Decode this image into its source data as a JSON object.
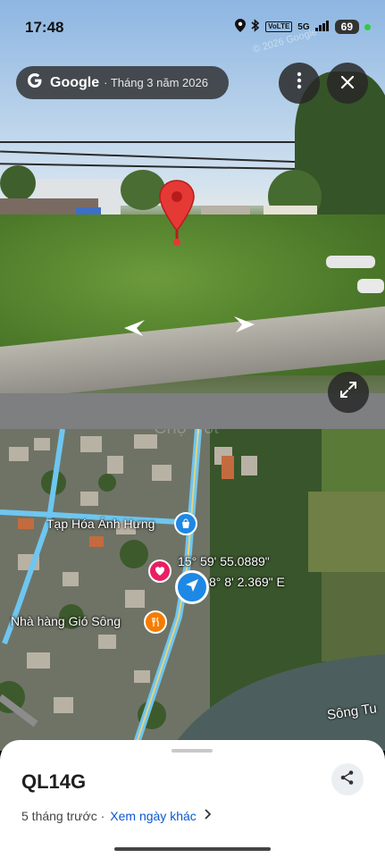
{
  "status_bar": {
    "time": "17:48",
    "battery": "69",
    "network": "5G",
    "volte": "VoLTE"
  },
  "street_view": {
    "brand": "Google",
    "capture_date": "· Tháng 3 năm 2026",
    "watermark": "© 2026 Google",
    "more_icon": "more-vert-icon",
    "close_icon": "close-icon",
    "expand_icon": "expand-icon"
  },
  "map": {
    "poi_labels": [
      "Tạp Hóa Ánh Hưng",
      "Nhà hàng Gió Sông"
    ],
    "river_label": "Sông Tu",
    "coords_lat": "15° 59' 55.0889\"",
    "coords_lon": "8° 8' 2.369\" E",
    "overlay_text": "Chợ Tốt"
  },
  "sheet": {
    "title": "QL14G",
    "time_ago": "5 tháng trước ·",
    "link": "Xem ngày khác",
    "share_icon": "share-icon"
  },
  "colors": {
    "pin": "#e53935",
    "road": "#6ec6f0",
    "link": "#0b57d0"
  }
}
